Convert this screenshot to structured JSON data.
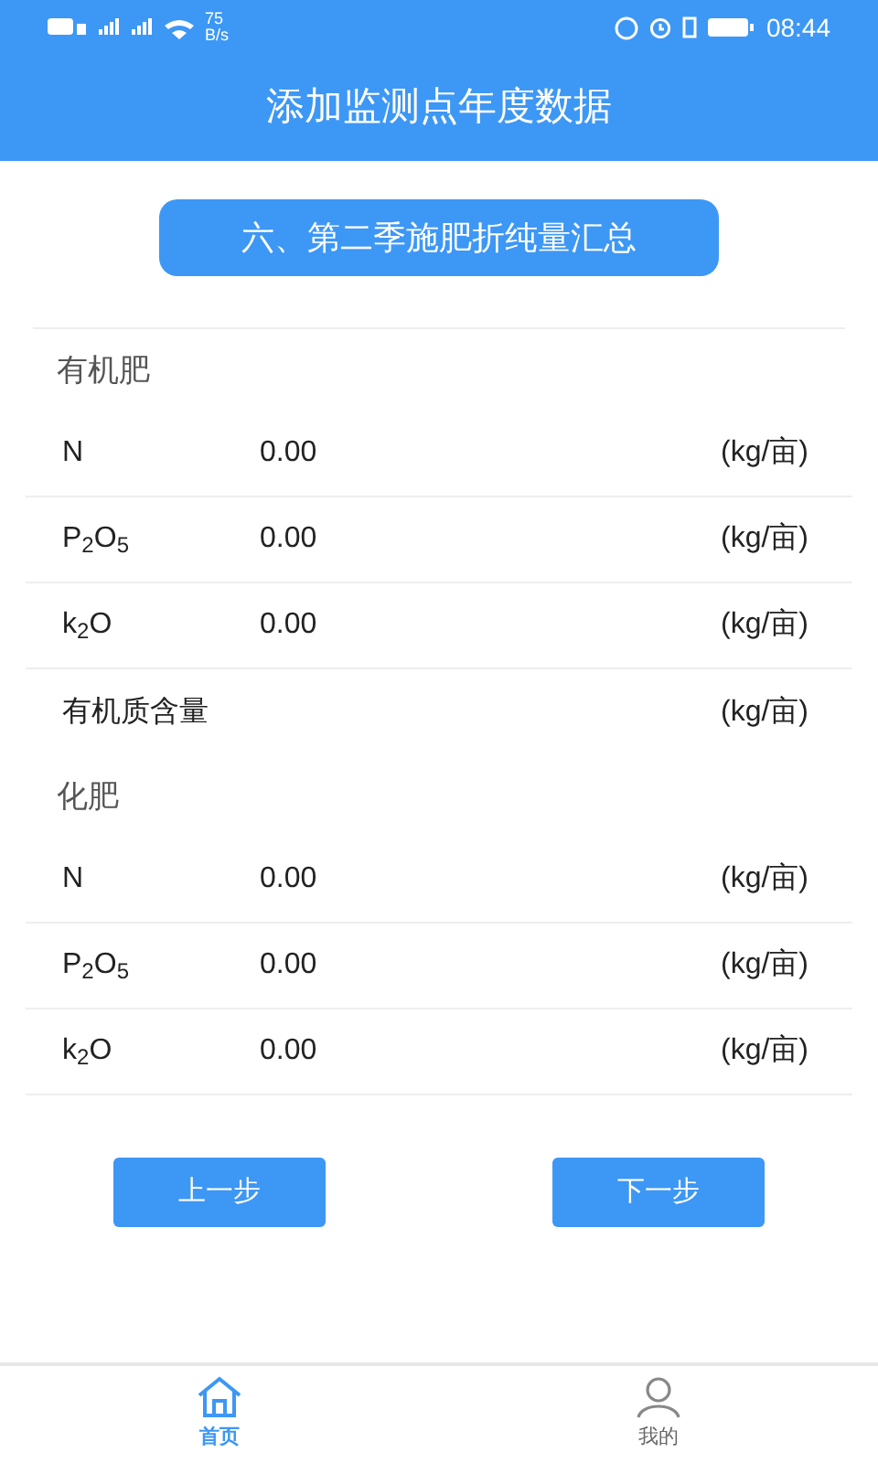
{
  "status_bar": {
    "network_speed": "75",
    "speed_unit": "B/s",
    "time": "08:44"
  },
  "header": {
    "title": "添加监测点年度数据"
  },
  "section_button": "六、第二季施肥折纯量汇总",
  "groups": [
    {
      "title": "有机肥",
      "rows": [
        {
          "name": "N",
          "value": "0.00",
          "unit": "(kg/亩)"
        },
        {
          "name": "P$_{2}$O$_{5}$",
          "value": "0.00",
          "unit": "(kg/亩)"
        },
        {
          "name": "k$_{2}$O",
          "value": "0.00",
          "unit": "(kg/亩)"
        },
        {
          "name": "有机质含量",
          "unit": "(kg/亩)"
        }
      ]
    },
    {
      "title": "化肥",
      "rows": [
        {
          "name": "N",
          "value": "0.00",
          "unit": "(kg/亩)"
        },
        {
          "name": "P$_{2}$O$_{5}$",
          "value": "0.00",
          "unit": "(kg/亩)"
        },
        {
          "name": "k$_{2}$O",
          "value": "0.00",
          "unit": "(kg/亩)"
        }
      ]
    }
  ],
  "buttons": [
    "上一步",
    "下一步"
  ],
  "nav": [
    {
      "label": "首页",
      "kind": "home",
      "selected": true
    },
    {
      "label": "我的",
      "kind": "profile",
      "selected": false
    }
  ]
}
